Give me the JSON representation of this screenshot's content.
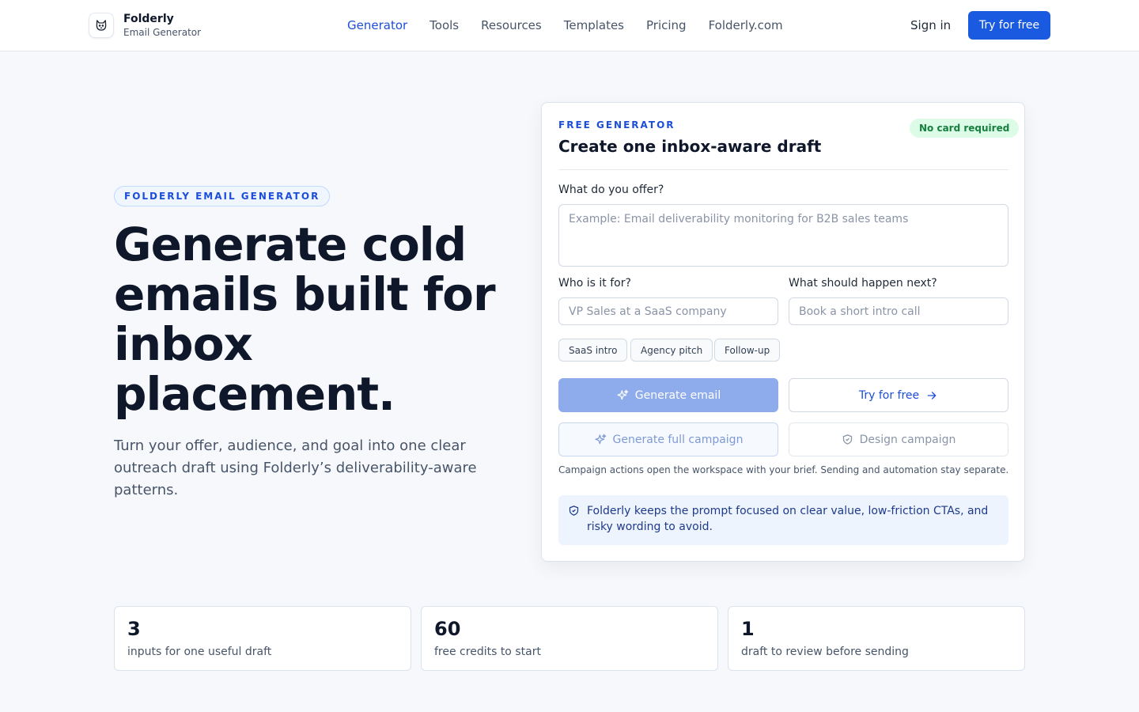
{
  "header": {
    "brand_name": "Folderly",
    "brand_sub": "Email Generator",
    "nav": [
      {
        "label": "Generator",
        "active": true
      },
      {
        "label": "Tools"
      },
      {
        "label": "Resources"
      },
      {
        "label": "Templates"
      },
      {
        "label": "Pricing"
      },
      {
        "label": "Folderly.com"
      }
    ],
    "signin_label": "Sign in",
    "cta_label": "Try for free",
    "accent_color": "#1a5ae0"
  },
  "hero": {
    "eyebrow": "FOLDERLY EMAIL GENERATOR",
    "title": "Generate cold emails built for inbox placement.",
    "subtitle": "Turn your offer, audience, and goal into one clear outreach draft using Folderly’s deliverability-aware patterns."
  },
  "generator": {
    "kicker": "FREE GENERATOR",
    "title": "Create one inbox-aware draft",
    "badge": "No card required",
    "offer_label": "What do you offer?",
    "offer_placeholder": "Example: Email deliverability monitoring for B2B sales teams",
    "offer_value": "",
    "audience_label": "Who is it for?",
    "audience_placeholder": "VP Sales at a SaaS company",
    "goal_label": "What should happen next?",
    "goal_placeholder": "Book a short intro call",
    "chips": [
      "SaaS intro",
      "Agency pitch",
      "Follow-up"
    ],
    "generate_label": "Generate email",
    "try_label": "Try for free",
    "campaign_label": "Generate full campaign",
    "design_label": "Design campaign",
    "note": "Campaign actions open the workspace with your brief. Sending and automation stay separate.",
    "info": "Folderly keeps the prompt focused on clear value, low-friction CTAs, and risky wording to avoid.",
    "icons": [
      "sparkle-icon",
      "arrow-right-icon",
      "shield-icon"
    ]
  },
  "stats": [
    {
      "value": "3",
      "label": "inputs for one useful draft"
    },
    {
      "value": "60",
      "label": "free credits to start"
    },
    {
      "value": "1",
      "label": "draft to review before sending"
    }
  ]
}
